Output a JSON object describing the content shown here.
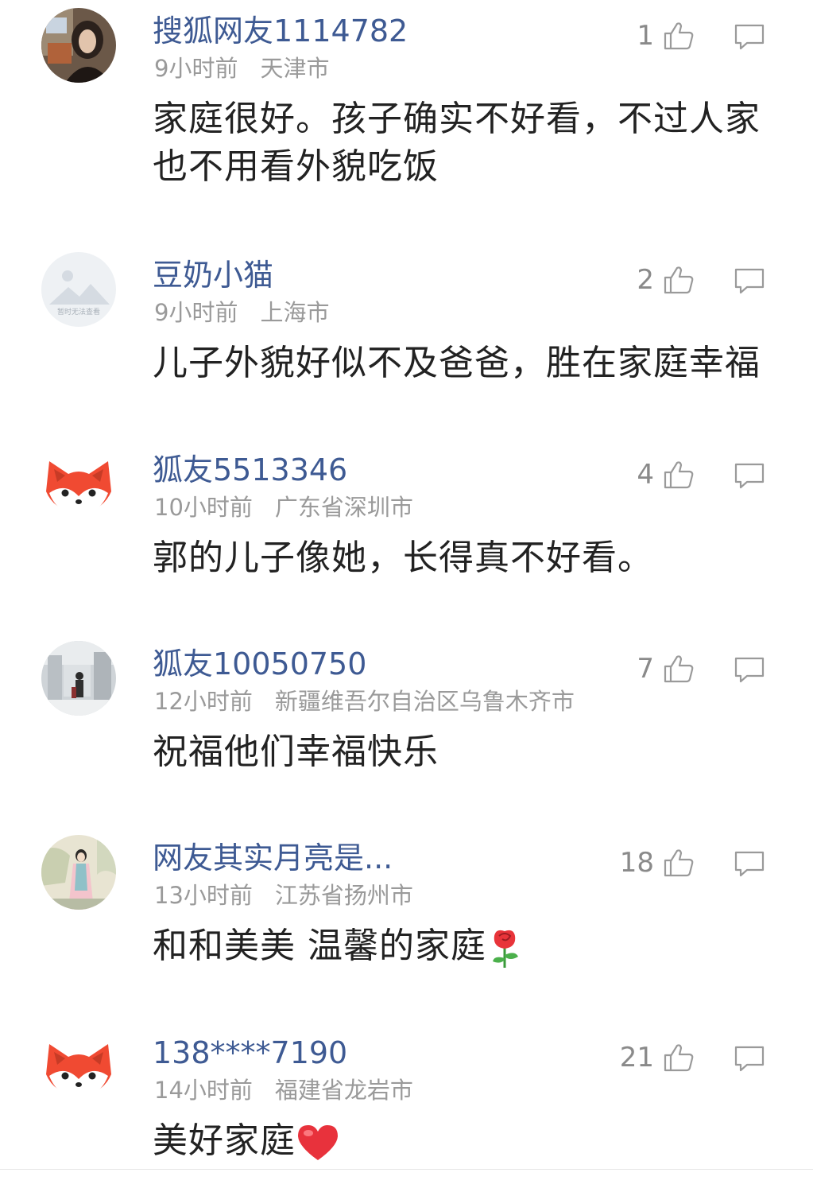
{
  "comments": [
    {
      "username": "搜狐网友1114782",
      "time": "9小时前",
      "location": "天津市",
      "likes": "1",
      "text": "家庭很好。孩子确实不好看，不过人家也不用看外貌吃饭",
      "avatar_icon": "user-photo-avatar"
    },
    {
      "username": "豆奶小猫",
      "time": "9小时前",
      "location": "上海市",
      "likes": "2",
      "text": "儿子外貌好似不及爸爸，胜在家庭幸福",
      "avatar_icon": "placeholder-avatar",
      "avatar_caption": "暂时无法查看"
    },
    {
      "username": "狐友5513346",
      "time": "10小时前",
      "location": "广东省深圳市",
      "likes": "4",
      "text": "郭的儿子像她，长得真不好看。",
      "avatar_icon": "fox-avatar"
    },
    {
      "username": "狐友10050750",
      "time": "12小时前",
      "location": "新疆维吾尔自治区乌鲁木齐市",
      "likes": "7",
      "text": "祝福他们幸福快乐",
      "avatar_icon": "snow-scene-avatar"
    },
    {
      "username": "网友其实月亮是...",
      "time": "13小时前",
      "location": "江苏省扬州市",
      "likes": "18",
      "text": "和和美美 温馨的家庭",
      "avatar_icon": "painting-avatar",
      "emoji": "rose-emoji"
    },
    {
      "username": "138****7190",
      "time": "14小时前",
      "location": "福建省龙岩市",
      "likes": "21",
      "text": "美好家庭",
      "avatar_icon": "fox-avatar",
      "emoji": "heart-emoji"
    }
  ],
  "colors": {
    "username": "#3e5a93",
    "meta": "#9a9a9a",
    "text": "#222222",
    "icon": "#9a9a9a",
    "fox": "#f04a32"
  }
}
